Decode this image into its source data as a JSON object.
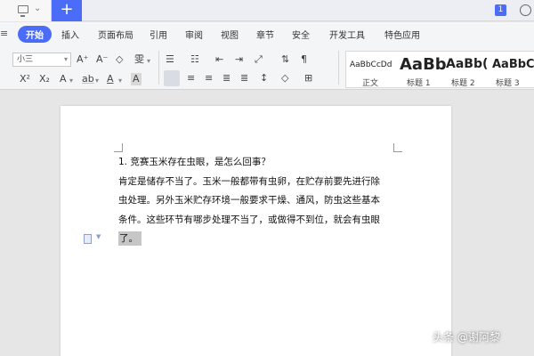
{
  "tabbar": {
    "plus": "+",
    "badge": "1"
  },
  "menu": {
    "hamburger": "≡",
    "items": [
      "开始",
      "插入",
      "页面布局",
      "引用",
      "审阅",
      "视图",
      "章节",
      "安全",
      "开发工具",
      "特色应用"
    ]
  },
  "toolbar": {
    "font_size": "小三",
    "grow_font": "A⁺",
    "shrink_font": "A⁻",
    "clear_format": "◇",
    "phonetic": "雯",
    "superscript": "X²",
    "subscript": "X₂",
    "text_effect": "A",
    "highlight": "ab",
    "font_color": "A",
    "char_shading": "A",
    "styles": [
      {
        "sample": "AaBbCcDd",
        "name": "正文"
      },
      {
        "sample": "AaBb",
        "name": "标题 1"
      },
      {
        "sample": "AaBb(",
        "name": "标题 2"
      },
      {
        "sample": "AaBbC",
        "name": "标题 3"
      }
    ]
  },
  "document": {
    "heading": "1. 竞赛玉米存在虫眼，是怎么回事？",
    "lines": [
      "肯定是储存不当了。玉米一般都带有虫卵，在贮存前要先进行除",
      "虫处理。另外玉米贮存环境一般要求干燥、通风，防虫这些基本",
      "条件。这些环节有哪步处理不当了，或做得不到位，就会有虫眼"
    ],
    "selected_text": "了。"
  },
  "watermark": "头条 @谢阿黎",
  "colors": {
    "accent": "#4a6cf7",
    "selection": "#c6c6c6"
  }
}
